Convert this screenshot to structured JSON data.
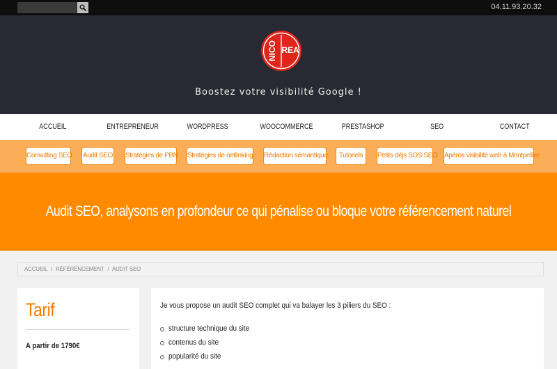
{
  "topbar": {
    "search_placeholder": "",
    "phone": "04.11.93.20.32"
  },
  "header": {
    "logo_left": "NICO",
    "logo_right": "REA",
    "tagline": "Boostez votre visibilité Google !"
  },
  "main_nav": {
    "items": [
      {
        "label": "ACCUEIL"
      },
      {
        "label": "ENTREPRENEUR"
      },
      {
        "label": "WORDPRESS"
      },
      {
        "label": "WOOCOMMERCE"
      },
      {
        "label": "PRESTASHOP"
      },
      {
        "label": "SEO"
      },
      {
        "label": "CONTACT"
      }
    ]
  },
  "sub_nav": {
    "items": [
      {
        "label": "Consulting SEO"
      },
      {
        "label": "Audit SEO"
      },
      {
        "label": "Stratégies de PBN"
      },
      {
        "label": "Stratégies de netlinking"
      },
      {
        "label": "Rédaction sémantique"
      },
      {
        "label": "Tutoriels"
      },
      {
        "label": "Petits déjs SOS SEO"
      },
      {
        "label": "Apéros visibilité web à Montpellier"
      }
    ]
  },
  "hero": {
    "title": "Audit SEO, analysons en profondeur ce qui pénalise ou bloque votre référencement naturel"
  },
  "breadcrumb": {
    "items": [
      {
        "label": "ACCUEIL"
      },
      {
        "label": "RÉFÉRENCEMENT"
      },
      {
        "label": "AUDIT SEO"
      }
    ],
    "separator": "/"
  },
  "sidebar": {
    "title": "Tarif",
    "price": "A partir de 1790€"
  },
  "content": {
    "intro": "Je vous propose un audit SEO complet qui va balayer les 3 piliers du SEO :",
    "list": [
      {
        "text": "structure technique du site"
      },
      {
        "text": "contenus du site"
      },
      {
        "text": "popularité du site"
      }
    ]
  },
  "colors": {
    "accent": "#ff8a00",
    "logo_red": "#e0251b",
    "header_bg": "#282a33",
    "subnav_bg": "#fbae57"
  }
}
